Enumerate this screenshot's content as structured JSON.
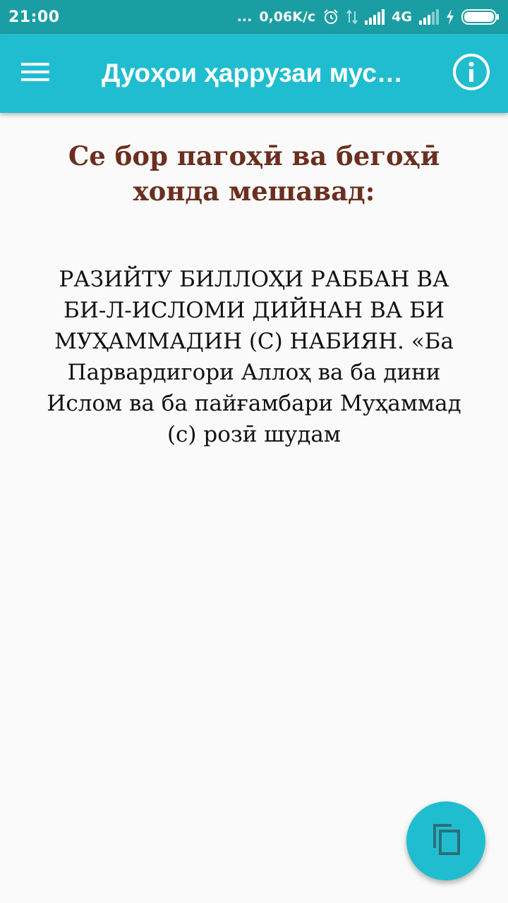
{
  "status_bar": {
    "time": "21:00",
    "dots": "...",
    "speed": "0,06K/c",
    "network": "4G",
    "icons": [
      "alarm-icon",
      "data-arrows-icon",
      "signal-icon",
      "signal-icon",
      "charging-icon",
      "battery-icon"
    ]
  },
  "app_bar": {
    "title": "Дуоҳои ҳаррузаи мусулмонон",
    "menu_icon": "hamburger-menu-icon",
    "info_icon": "info-icon"
  },
  "content": {
    "heading": "Се бор пагоҳӣ ва бегоҳӣ хонда мешавад:",
    "body": "РАЗИЙТУ БИЛЛОҲИ РАББАН ВА БИ-Л-ИСЛОМИ ДИЙНАН ВА БИ МУҲАММАДИН (С) НАБИЯН. «Ба Парвардигори Аллоҳ ва ба дини Ислом ва ба пайғамбари Муҳаммад (с) розӣ шудам"
  },
  "fab": {
    "icon": "copy-icon"
  },
  "colors": {
    "status_bar": "#1a9ea3",
    "app_bar": "#20bdd0",
    "heading": "#6b2f1f",
    "background": "#fafafa"
  }
}
